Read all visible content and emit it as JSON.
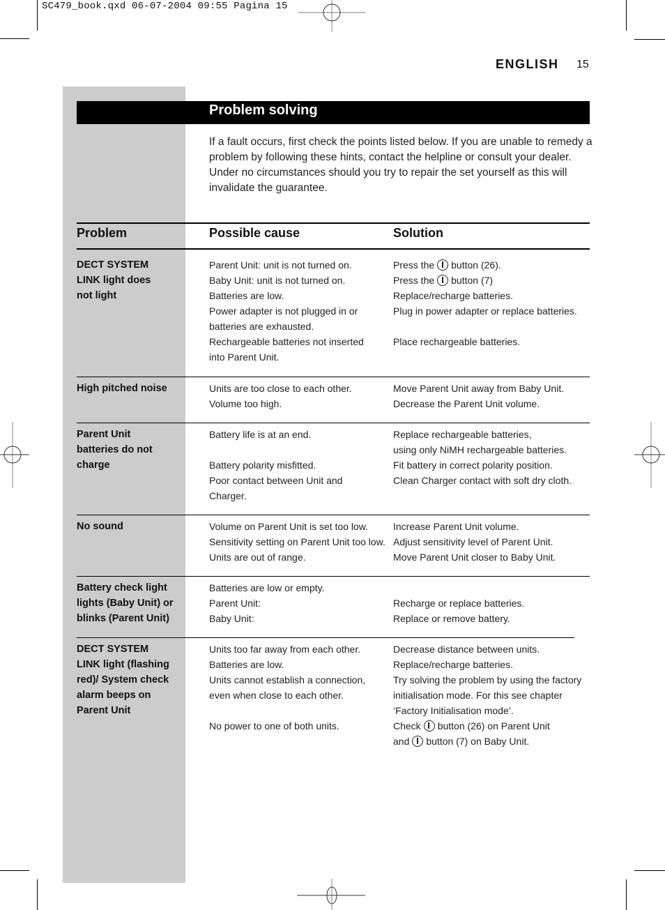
{
  "slug": "SC479_book.qxd 06-07-2004 09:55 Pagina 15",
  "header": {
    "language": "ENGLISH",
    "page_number": "15"
  },
  "section": {
    "title": "Problem solving",
    "intro": [
      "If a fault occurs, first check the points listed below. If you are unable to remedy a problem by following these hints, contact the helpline or consult your dealer.",
      "Under no circumstances should you try to repair the set yourself as this will invalidate the guarantee."
    ]
  },
  "table": {
    "headers": {
      "problem": "Problem",
      "cause": "Possible cause",
      "solution": "Solution"
    },
    "rows": [
      {
        "problem": [
          "DECT SYSTEM",
          "LINK light does",
          "not light"
        ],
        "causes": [
          "Parent Unit: unit is not turned on.",
          "Baby Unit: unit is not turned on.",
          "Batteries are low.",
          "Power adapter is not plugged in or",
          "batteries are exhausted.",
          "Rechargeable batteries not inserted",
          "into Parent Unit."
        ],
        "solutions": [
          {
            "pre": "Press the",
            "icon": "power-button-icon",
            "post": "button (26)."
          },
          {
            "pre": "Press the",
            "icon": "power-button-icon",
            "post": "button (7)"
          },
          {
            "text": "Replace/recharge batteries."
          },
          {
            "text": "Plug in power adapter or replace batteries."
          },
          {
            "text": ""
          },
          {
            "text": "Place rechargeable batteries."
          }
        ]
      },
      {
        "problem": [
          "High pitched noise"
        ],
        "causes": [
          "Units are too close to each other.",
          "Volume too high."
        ],
        "solutions": [
          {
            "text": "Move Parent Unit away from Baby Unit."
          },
          {
            "text": "Decrease the Parent Unit volume."
          }
        ]
      },
      {
        "problem": [
          "Parent Unit",
          "batteries do not",
          "charge"
        ],
        "causes": [
          "Battery life is at an end.",
          "",
          "Battery polarity misfitted.",
          "Poor contact between Unit and",
          "Charger."
        ],
        "solutions": [
          {
            "text": "Replace rechargeable batteries,"
          },
          {
            "text": "using only NiMH rechargeable batteries."
          },
          {
            "text": "Fit battery in correct polarity position."
          },
          {
            "text": "Clean Charger contact with soft dry cloth."
          }
        ]
      },
      {
        "problem": [
          "No sound"
        ],
        "causes": [
          "Volume on Parent Unit is set too low.",
          "Sensitivity setting on Parent Unit too low.",
          "Units are out of range."
        ],
        "solutions": [
          {
            "text": "Increase Parent Unit volume."
          },
          {
            "text": "Adjust sensitivity level of Parent Unit."
          },
          {
            "text": "Move Parent Unit closer to Baby Unit."
          }
        ]
      },
      {
        "problem": [
          "Battery check light",
          "lights (Baby Unit) or",
          "blinks (Parent Unit)"
        ],
        "causes": [
          "Batteries are low or empty.",
          "Parent Unit:",
          "Baby Unit:"
        ],
        "solutions": [
          {
            "text": ""
          },
          {
            "text": "Recharge or replace batteries."
          },
          {
            "text": "Replace or remove battery."
          }
        ]
      },
      {
        "problem": [
          "DECT SYSTEM",
          "LINK light (flashing",
          "red)/ System check",
          "alarm beeps on",
          "Parent Unit"
        ],
        "causes": [
          "Units too far away from each other.",
          "Batteries are low.",
          "Units cannot establish a connection,",
          "even when close to each other.",
          "",
          "No power to one of both units."
        ],
        "solutions": [
          {
            "text": "Decrease distance between units."
          },
          {
            "text": "Replace/recharge batteries."
          },
          {
            "text": "Try solving the problem by using the factory"
          },
          {
            "text": "initialisation mode. For this see chapter"
          },
          {
            "text": "‘Factory Initialisation mode’."
          },
          {
            "pre": "Check",
            "icon": "power-button-icon",
            "post": "button (26) on Parent Unit"
          },
          {
            "pre": "and",
            "icon": "power-button-icon",
            "post": "button (7) on Baby Unit."
          }
        ]
      }
    ]
  }
}
